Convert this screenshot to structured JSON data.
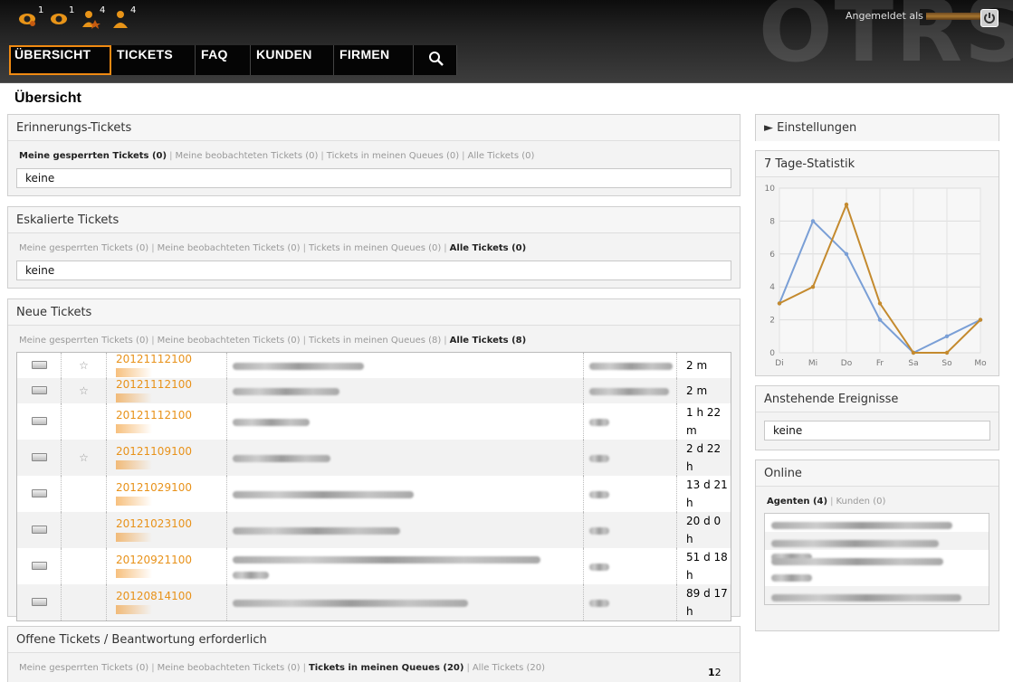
{
  "header": {
    "brand": "OTRS",
    "login_label": "Angemeldet als",
    "toolbar_counts": [
      "1",
      "1",
      "4",
      "4"
    ],
    "nav": [
      {
        "label": "ÜBERSICHT",
        "active": true
      },
      {
        "label": "TICKETS",
        "active": false
      },
      {
        "label": "FAQ",
        "active": false
      },
      {
        "label": "KUNDEN",
        "active": false
      },
      {
        "label": "FIRMEN",
        "active": false
      }
    ],
    "accent_color": "#f08a12"
  },
  "page_title": "Übersicht",
  "reminder": {
    "title": "Erinnerungs-Tickets",
    "filters": [
      "Meine gesperrten Tickets (0)",
      "Meine beobachteten Tickets (0)",
      "Tickets in meinen Queues (0)",
      "Alle Tickets (0)"
    ],
    "active_filter": 0,
    "empty": "keine"
  },
  "escalated": {
    "title": "Eskalierte Tickets",
    "filters": [
      "Meine gesperrten Tickets (0)",
      "Meine beobachteten Tickets (0)",
      "Tickets in meinen Queues (0)",
      "Alle Tickets (0)"
    ],
    "active_filter": 3,
    "empty": "keine"
  },
  "new_tickets": {
    "title": "Neue Tickets",
    "filters": [
      "Meine gesperrten Tickets (0)",
      "Meine beobachteten Tickets (0)",
      "Tickets in meinen Queues (8)",
      "Alle Tickets (8)"
    ],
    "active_filter": 3,
    "rows": [
      {
        "number": "20121112100",
        "age": "2 m",
        "star": true
      },
      {
        "number": "20121112100",
        "age": "2 m",
        "star": true
      },
      {
        "number": "20121112100",
        "age": "1 h 22 m",
        "star": false
      },
      {
        "number": "20121109100",
        "age": "2 d 22 h",
        "star": true
      },
      {
        "number": "20121029100",
        "age": "13 d 21 h",
        "star": false
      },
      {
        "number": "20121023100",
        "age": "20 d 0 h",
        "star": false
      },
      {
        "number": "20120921100",
        "age": "51 d 18 h",
        "star": false
      },
      {
        "number": "20120814100",
        "age": "89 d 17 h",
        "star": false
      }
    ]
  },
  "open_tickets": {
    "title": "Offene Tickets / Beantwortung erforderlich",
    "filters": [
      "Meine gesperrten Tickets (0)",
      "Meine beobachteten Tickets (0)",
      "Tickets in meinen Queues (20)",
      "Alle Tickets (20)"
    ],
    "active_filter": 2,
    "pages": [
      "1",
      "2"
    ]
  },
  "settings": {
    "title": "► Einstellungen"
  },
  "stats": {
    "title": "7 Tage-Statistik"
  },
  "chart_data": {
    "type": "line",
    "title": "7 Tage-Statistik",
    "categories": [
      "Di",
      "Mi",
      "Do",
      "Fr",
      "Sa",
      "So",
      "Mo"
    ],
    "ylim": [
      0,
      10
    ],
    "yticks": [
      0,
      2,
      4,
      6,
      8,
      10
    ],
    "grid": true,
    "series": [
      {
        "values": [
          3,
          8,
          6,
          2,
          0,
          1,
          2
        ],
        "color": "#7a9fd6"
      },
      {
        "values": [
          3,
          4,
          9,
          3,
          0,
          0,
          2
        ],
        "color": "#c48a2e"
      }
    ]
  },
  "events": {
    "title": "Anstehende Ereignisse",
    "empty": "keine"
  },
  "online": {
    "title": "Online",
    "tabs": [
      "Agenten (4)",
      "Kunden (0)"
    ],
    "active_tab": 0,
    "rows": 4
  }
}
